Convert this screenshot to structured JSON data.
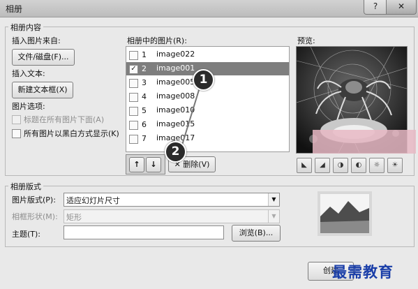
{
  "window": {
    "title": "相册",
    "help_glyph": "?",
    "close_glyph": "✕"
  },
  "content_group": {
    "label": "相册内容"
  },
  "insert_from": {
    "label": "插入图片来自:",
    "file_button": "文件/磁盘(F)..."
  },
  "insert_text": {
    "label": "插入文本:",
    "new_textbox_button": "新建文本框(X)"
  },
  "picture_options": {
    "label": "图片选项:",
    "captions": {
      "label": "标题在所有图片下面(A)",
      "checked": false,
      "disabled": true
    },
    "bw": {
      "label": "所有图片以黑白方式显示(K)",
      "checked": false,
      "disabled": false
    }
  },
  "pictures": {
    "label": "相册中的图片(R):",
    "items": [
      {
        "num": "1",
        "name": "image022",
        "checked": false,
        "selected": false
      },
      {
        "num": "2",
        "name": "image001",
        "checked": true,
        "selected": true
      },
      {
        "num": "3",
        "name": "image005",
        "checked": false,
        "selected": false
      },
      {
        "num": "4",
        "name": "image008",
        "checked": false,
        "selected": false
      },
      {
        "num": "5",
        "name": "image010",
        "checked": false,
        "selected": false
      },
      {
        "num": "6",
        "name": "image015",
        "checked": false,
        "selected": false
      },
      {
        "num": "7",
        "name": "image017",
        "checked": false,
        "selected": false
      }
    ],
    "up_glyph": "↑",
    "down_glyph": "↓",
    "delete_glyph": "✕",
    "delete_label": "删除(V)"
  },
  "preview": {
    "label": "预览:"
  },
  "image_tools": [
    "rotate-left-icon",
    "rotate-right-icon",
    "contrast-up-icon",
    "contrast-down-icon",
    "brightness-up-icon",
    "brightness-down-icon"
  ],
  "layout_group": {
    "label": "相册版式"
  },
  "picture_layout": {
    "label": "图片版式(P):",
    "value": "适应幻灯片尺寸"
  },
  "frame_shape": {
    "label": "相框形状(M):",
    "value": "矩形"
  },
  "theme": {
    "label": "主题(T):",
    "value": "",
    "browse_button": "浏览(B)..."
  },
  "create_button": "创建",
  "callouts": [
    "1",
    "2"
  ],
  "watermark": "最需教育"
}
